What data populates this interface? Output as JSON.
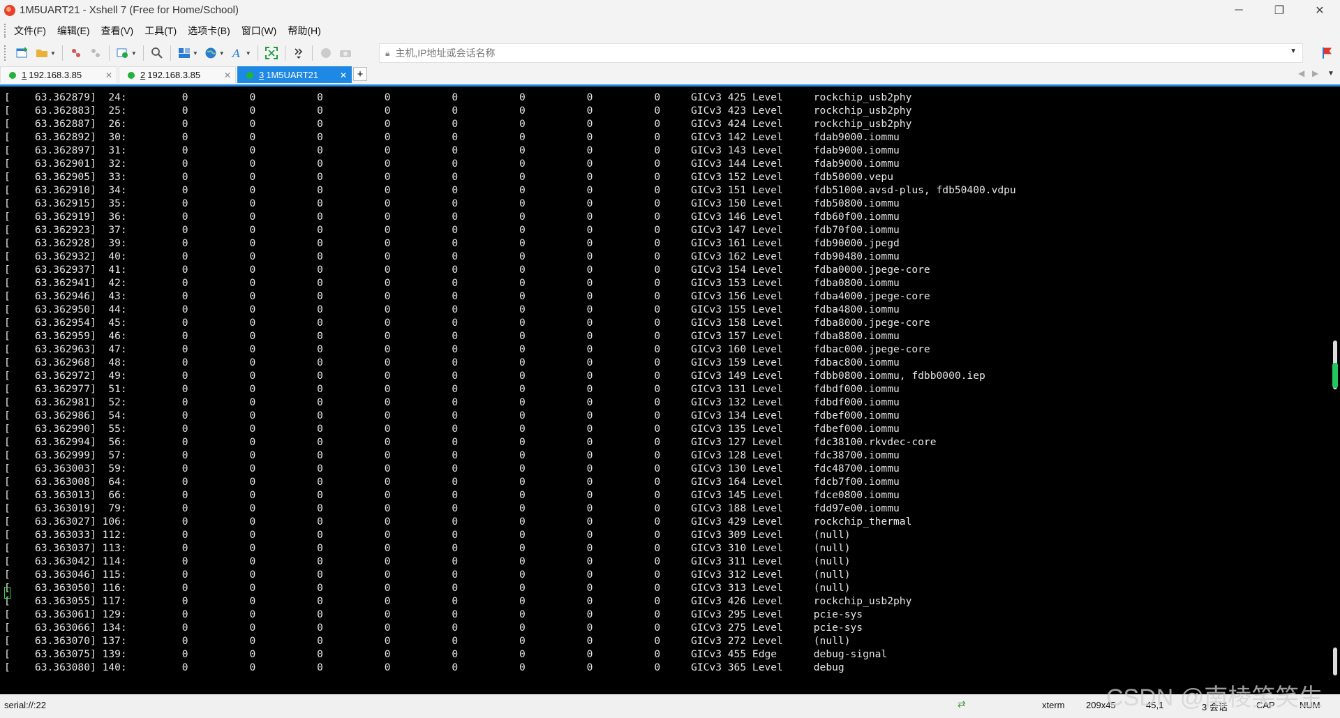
{
  "window": {
    "title": "1M5UART21 - Xshell 7 (Free for Home/School)",
    "minimize": "─",
    "restore": "❐",
    "close": "✕"
  },
  "menu": [
    "文件(F)",
    "编辑(E)",
    "查看(V)",
    "工具(T)",
    "选项卡(B)",
    "窗口(W)",
    "帮助(H)"
  ],
  "address": {
    "placeholder": "主机,IP地址或会话名称"
  },
  "tabs": [
    {
      "num": "1",
      "label": "192.168.3.85",
      "close": "✕"
    },
    {
      "num": "2",
      "label": "192.168.3.85",
      "close": "✕"
    },
    {
      "num": "3",
      "label": "1M5UART21",
      "close": "✕"
    }
  ],
  "tab_add": "+",
  "terminal": {
    "rows": [
      {
        "ts": "63.362879",
        "irq": "24",
        "counts": [
          "0",
          "0",
          "0",
          "0",
          "0",
          "0",
          "0",
          "0"
        ],
        "chip": "GICv3",
        "hw": "425",
        "type": "Level",
        "dev": "rockchip_usb2phy"
      },
      {
        "ts": "63.362883",
        "irq": "25",
        "counts": [
          "0",
          "0",
          "0",
          "0",
          "0",
          "0",
          "0",
          "0"
        ],
        "chip": "GICv3",
        "hw": "423",
        "type": "Level",
        "dev": "rockchip_usb2phy"
      },
      {
        "ts": "63.362887",
        "irq": "26",
        "counts": [
          "0",
          "0",
          "0",
          "0",
          "0",
          "0",
          "0",
          "0"
        ],
        "chip": "GICv3",
        "hw": "424",
        "type": "Level",
        "dev": "rockchip_usb2phy"
      },
      {
        "ts": "63.362892",
        "irq": "30",
        "counts": [
          "0",
          "0",
          "0",
          "0",
          "0",
          "0",
          "0",
          "0"
        ],
        "chip": "GICv3",
        "hw": "142",
        "type": "Level",
        "dev": "fdab9000.iommu"
      },
      {
        "ts": "63.362897",
        "irq": "31",
        "counts": [
          "0",
          "0",
          "0",
          "0",
          "0",
          "0",
          "0",
          "0"
        ],
        "chip": "GICv3",
        "hw": "143",
        "type": "Level",
        "dev": "fdab9000.iommu"
      },
      {
        "ts": "63.362901",
        "irq": "32",
        "counts": [
          "0",
          "0",
          "0",
          "0",
          "0",
          "0",
          "0",
          "0"
        ],
        "chip": "GICv3",
        "hw": "144",
        "type": "Level",
        "dev": "fdab9000.iommu"
      },
      {
        "ts": "63.362905",
        "irq": "33",
        "counts": [
          "0",
          "0",
          "0",
          "0",
          "0",
          "0",
          "0",
          "0"
        ],
        "chip": "GICv3",
        "hw": "152",
        "type": "Level",
        "dev": "fdb50000.vepu"
      },
      {
        "ts": "63.362910",
        "irq": "34",
        "counts": [
          "0",
          "0",
          "0",
          "0",
          "0",
          "0",
          "0",
          "0"
        ],
        "chip": "GICv3",
        "hw": "151",
        "type": "Level",
        "dev": "fdb51000.avsd-plus, fdb50400.vdpu"
      },
      {
        "ts": "63.362915",
        "irq": "35",
        "counts": [
          "0",
          "0",
          "0",
          "0",
          "0",
          "0",
          "0",
          "0"
        ],
        "chip": "GICv3",
        "hw": "150",
        "type": "Level",
        "dev": "fdb50800.iommu"
      },
      {
        "ts": "63.362919",
        "irq": "36",
        "counts": [
          "0",
          "0",
          "0",
          "0",
          "0",
          "0",
          "0",
          "0"
        ],
        "chip": "GICv3",
        "hw": "146",
        "type": "Level",
        "dev": "fdb60f00.iommu"
      },
      {
        "ts": "63.362923",
        "irq": "37",
        "counts": [
          "0",
          "0",
          "0",
          "0",
          "0",
          "0",
          "0",
          "0"
        ],
        "chip": "GICv3",
        "hw": "147",
        "type": "Level",
        "dev": "fdb70f00.iommu"
      },
      {
        "ts": "63.362928",
        "irq": "39",
        "counts": [
          "0",
          "0",
          "0",
          "0",
          "0",
          "0",
          "0",
          "0"
        ],
        "chip": "GICv3",
        "hw": "161",
        "type": "Level",
        "dev": "fdb90000.jpegd"
      },
      {
        "ts": "63.362932",
        "irq": "40",
        "counts": [
          "0",
          "0",
          "0",
          "0",
          "0",
          "0",
          "0",
          "0"
        ],
        "chip": "GICv3",
        "hw": "162",
        "type": "Level",
        "dev": "fdb90480.iommu"
      },
      {
        "ts": "63.362937",
        "irq": "41",
        "counts": [
          "0",
          "0",
          "0",
          "0",
          "0",
          "0",
          "0",
          "0"
        ],
        "chip": "GICv3",
        "hw": "154",
        "type": "Level",
        "dev": "fdba0000.jpege-core"
      },
      {
        "ts": "63.362941",
        "irq": "42",
        "counts": [
          "0",
          "0",
          "0",
          "0",
          "0",
          "0",
          "0",
          "0"
        ],
        "chip": "GICv3",
        "hw": "153",
        "type": "Level",
        "dev": "fdba0800.iommu"
      },
      {
        "ts": "63.362946",
        "irq": "43",
        "counts": [
          "0",
          "0",
          "0",
          "0",
          "0",
          "0",
          "0",
          "0"
        ],
        "chip": "GICv3",
        "hw": "156",
        "type": "Level",
        "dev": "fdba4000.jpege-core"
      },
      {
        "ts": "63.362950",
        "irq": "44",
        "counts": [
          "0",
          "0",
          "0",
          "0",
          "0",
          "0",
          "0",
          "0"
        ],
        "chip": "GICv3",
        "hw": "155",
        "type": "Level",
        "dev": "fdba4800.iommu"
      },
      {
        "ts": "63.362954",
        "irq": "45",
        "counts": [
          "0",
          "0",
          "0",
          "0",
          "0",
          "0",
          "0",
          "0"
        ],
        "chip": "GICv3",
        "hw": "158",
        "type": "Level",
        "dev": "fdba8000.jpege-core"
      },
      {
        "ts": "63.362959",
        "irq": "46",
        "counts": [
          "0",
          "0",
          "0",
          "0",
          "0",
          "0",
          "0",
          "0"
        ],
        "chip": "GICv3",
        "hw": "157",
        "type": "Level",
        "dev": "fdba8800.iommu"
      },
      {
        "ts": "63.362963",
        "irq": "47",
        "counts": [
          "0",
          "0",
          "0",
          "0",
          "0",
          "0",
          "0",
          "0"
        ],
        "chip": "GICv3",
        "hw": "160",
        "type": "Level",
        "dev": "fdbac000.jpege-core"
      },
      {
        "ts": "63.362968",
        "irq": "48",
        "counts": [
          "0",
          "0",
          "0",
          "0",
          "0",
          "0",
          "0",
          "0"
        ],
        "chip": "GICv3",
        "hw": "159",
        "type": "Level",
        "dev": "fdbac800.iommu"
      },
      {
        "ts": "63.362972",
        "irq": "49",
        "counts": [
          "0",
          "0",
          "0",
          "0",
          "0",
          "0",
          "0",
          "0"
        ],
        "chip": "GICv3",
        "hw": "149",
        "type": "Level",
        "dev": "fdbb0800.iommu, fdbb0000.iep"
      },
      {
        "ts": "63.362977",
        "irq": "51",
        "counts": [
          "0",
          "0",
          "0",
          "0",
          "0",
          "0",
          "0",
          "0"
        ],
        "chip": "GICv3",
        "hw": "131",
        "type": "Level",
        "dev": "fdbdf000.iommu"
      },
      {
        "ts": "63.362981",
        "irq": "52",
        "counts": [
          "0",
          "0",
          "0",
          "0",
          "0",
          "0",
          "0",
          "0"
        ],
        "chip": "GICv3",
        "hw": "132",
        "type": "Level",
        "dev": "fdbdf000.iommu"
      },
      {
        "ts": "63.362986",
        "irq": "54",
        "counts": [
          "0",
          "0",
          "0",
          "0",
          "0",
          "0",
          "0",
          "0"
        ],
        "chip": "GICv3",
        "hw": "134",
        "type": "Level",
        "dev": "fdbef000.iommu"
      },
      {
        "ts": "63.362990",
        "irq": "55",
        "counts": [
          "0",
          "0",
          "0",
          "0",
          "0",
          "0",
          "0",
          "0"
        ],
        "chip": "GICv3",
        "hw": "135",
        "type": "Level",
        "dev": "fdbef000.iommu"
      },
      {
        "ts": "63.362994",
        "irq": "56",
        "counts": [
          "0",
          "0",
          "0",
          "0",
          "0",
          "0",
          "0",
          "0"
        ],
        "chip": "GICv3",
        "hw": "127",
        "type": "Level",
        "dev": "fdc38100.rkvdec-core"
      },
      {
        "ts": "63.362999",
        "irq": "57",
        "counts": [
          "0",
          "0",
          "0",
          "0",
          "0",
          "0",
          "0",
          "0"
        ],
        "chip": "GICv3",
        "hw": "128",
        "type": "Level",
        "dev": "fdc38700.iommu"
      },
      {
        "ts": "63.363003",
        "irq": "59",
        "counts": [
          "0",
          "0",
          "0",
          "0",
          "0",
          "0",
          "0",
          "0"
        ],
        "chip": "GICv3",
        "hw": "130",
        "type": "Level",
        "dev": "fdc48700.iommu"
      },
      {
        "ts": "63.363008",
        "irq": "64",
        "counts": [
          "0",
          "0",
          "0",
          "0",
          "0",
          "0",
          "0",
          "0"
        ],
        "chip": "GICv3",
        "hw": "164",
        "type": "Level",
        "dev": "fdcb7f00.iommu"
      },
      {
        "ts": "63.363013",
        "irq": "66",
        "counts": [
          "0",
          "0",
          "0",
          "0",
          "0",
          "0",
          "0",
          "0"
        ],
        "chip": "GICv3",
        "hw": "145",
        "type": "Level",
        "dev": "fdce0800.iommu"
      },
      {
        "ts": "63.363019",
        "irq": "79",
        "counts": [
          "0",
          "0",
          "0",
          "0",
          "0",
          "0",
          "0",
          "0"
        ],
        "chip": "GICv3",
        "hw": "188",
        "type": "Level",
        "dev": "fdd97e00.iommu"
      },
      {
        "ts": "63.363027",
        "irq": "106",
        "counts": [
          "0",
          "0",
          "0",
          "0",
          "0",
          "0",
          "0",
          "0"
        ],
        "chip": "GICv3",
        "hw": "429",
        "type": "Level",
        "dev": "rockchip_thermal"
      },
      {
        "ts": "63.363033",
        "irq": "112",
        "counts": [
          "0",
          "0",
          "0",
          "0",
          "0",
          "0",
          "0",
          "0"
        ],
        "chip": "GICv3",
        "hw": "309",
        "type": "Level",
        "dev": "(null)"
      },
      {
        "ts": "63.363037",
        "irq": "113",
        "counts": [
          "0",
          "0",
          "0",
          "0",
          "0",
          "0",
          "0",
          "0"
        ],
        "chip": "GICv3",
        "hw": "310",
        "type": "Level",
        "dev": "(null)"
      },
      {
        "ts": "63.363042",
        "irq": "114",
        "counts": [
          "0",
          "0",
          "0",
          "0",
          "0",
          "0",
          "0",
          "0"
        ],
        "chip": "GICv3",
        "hw": "311",
        "type": "Level",
        "dev": "(null)"
      },
      {
        "ts": "63.363046",
        "irq": "115",
        "counts": [
          "0",
          "0",
          "0",
          "0",
          "0",
          "0",
          "0",
          "0"
        ],
        "chip": "GICv3",
        "hw": "312",
        "type": "Level",
        "dev": "(null)"
      },
      {
        "ts": "63.363050",
        "irq": "116",
        "counts": [
          "0",
          "0",
          "0",
          "0",
          "0",
          "0",
          "0",
          "0"
        ],
        "chip": "GICv3",
        "hw": "313",
        "type": "Level",
        "dev": "(null)"
      },
      {
        "ts": "63.363055",
        "irq": "117",
        "counts": [
          "0",
          "0",
          "0",
          "0",
          "0",
          "0",
          "0",
          "0"
        ],
        "chip": "GICv3",
        "hw": "426",
        "type": "Level",
        "dev": "rockchip_usb2phy"
      },
      {
        "ts": "63.363061",
        "irq": "129",
        "counts": [
          "0",
          "0",
          "0",
          "0",
          "0",
          "0",
          "0",
          "0"
        ],
        "chip": "GICv3",
        "hw": "295",
        "type": "Level",
        "dev": "pcie-sys"
      },
      {
        "ts": "63.363066",
        "irq": "134",
        "counts": [
          "0",
          "0",
          "0",
          "0",
          "0",
          "0",
          "0",
          "0"
        ],
        "chip": "GICv3",
        "hw": "275",
        "type": "Level",
        "dev": "pcie-sys"
      },
      {
        "ts": "63.363070",
        "irq": "137",
        "counts": [
          "0",
          "0",
          "0",
          "0",
          "0",
          "0",
          "0",
          "0"
        ],
        "chip": "GICv3",
        "hw": "272",
        "type": "Level",
        "dev": "(null)"
      },
      {
        "ts": "63.363075",
        "irq": "139",
        "counts": [
          "0",
          "0",
          "0",
          "0",
          "0",
          "0",
          "0",
          "0"
        ],
        "chip": "GICv3",
        "hw": "455",
        "type": "Edge",
        "dev": "debug-signal"
      },
      {
        "ts": "63.363080",
        "irq": "140",
        "counts": [
          "0",
          "0",
          "0",
          "0",
          "0",
          "0",
          "0",
          "0"
        ],
        "chip": "GICv3",
        "hw": "365",
        "type": "Level",
        "dev": "debug"
      }
    ]
  },
  "status": {
    "connection": "serial://:22",
    "term_type": "xterm",
    "size": "209x45",
    "cursor_pos": "45,1",
    "sessions": "3 会话",
    "caps": "CAP",
    "num": "NUM"
  },
  "watermark": "CSDN @南棱笑笑生"
}
